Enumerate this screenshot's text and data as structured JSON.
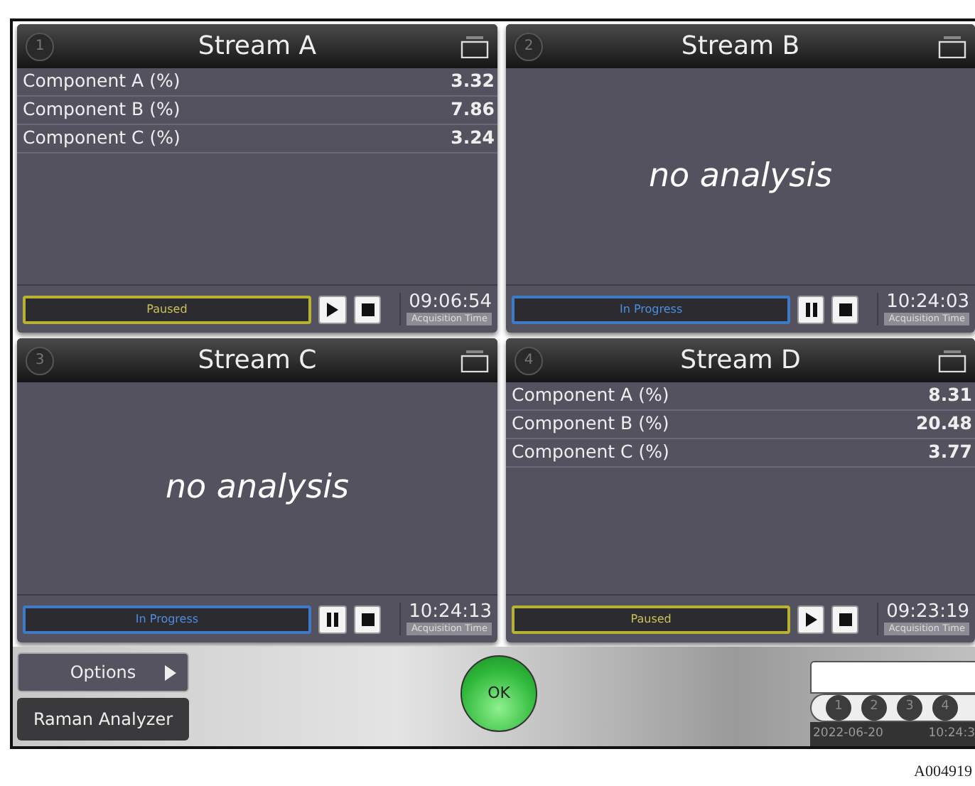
{
  "streams": [
    {
      "number": "1",
      "title": "Stream A",
      "components": [
        {
          "label": "Component A (%)",
          "value": "3.32"
        },
        {
          "label": "Component B (%)",
          "value": "7.86"
        },
        {
          "label": "Component C (%)",
          "value": "3.24"
        }
      ],
      "paused": true,
      "status_text": "Paused",
      "time": "09:06:54",
      "time_label": "Acquisition Time"
    },
    {
      "number": "2",
      "title": "Stream B",
      "message": "no analysis",
      "paused": false,
      "status_text": "In Progress",
      "time": "10:24:03",
      "time_label": "Acquisition Time"
    },
    {
      "number": "3",
      "title": "Stream C",
      "message": "no analysis",
      "paused": false,
      "status_text": "In Progress",
      "time": "10:24:13",
      "time_label": "Acquisition Time"
    },
    {
      "number": "4",
      "title": "Stream D",
      "components": [
        {
          "label": "Component A (%)",
          "value": "8.31"
        },
        {
          "label": "Component B (%)",
          "value": "20.48"
        },
        {
          "label": "Component C (%)",
          "value": "3.77"
        }
      ],
      "paused": true,
      "status_text": "Paused",
      "time": "09:23:19",
      "time_label": "Acquisition Time"
    }
  ],
  "bottom_bar": {
    "options_button": "Options",
    "analyzer_button": "Raman Analyzer",
    "ok_indicator": "OK",
    "stream_indicators": [
      "1",
      "2",
      "3",
      "4"
    ],
    "date": "2022-06-20",
    "time": "10:24:3"
  },
  "caption": "A004919"
}
